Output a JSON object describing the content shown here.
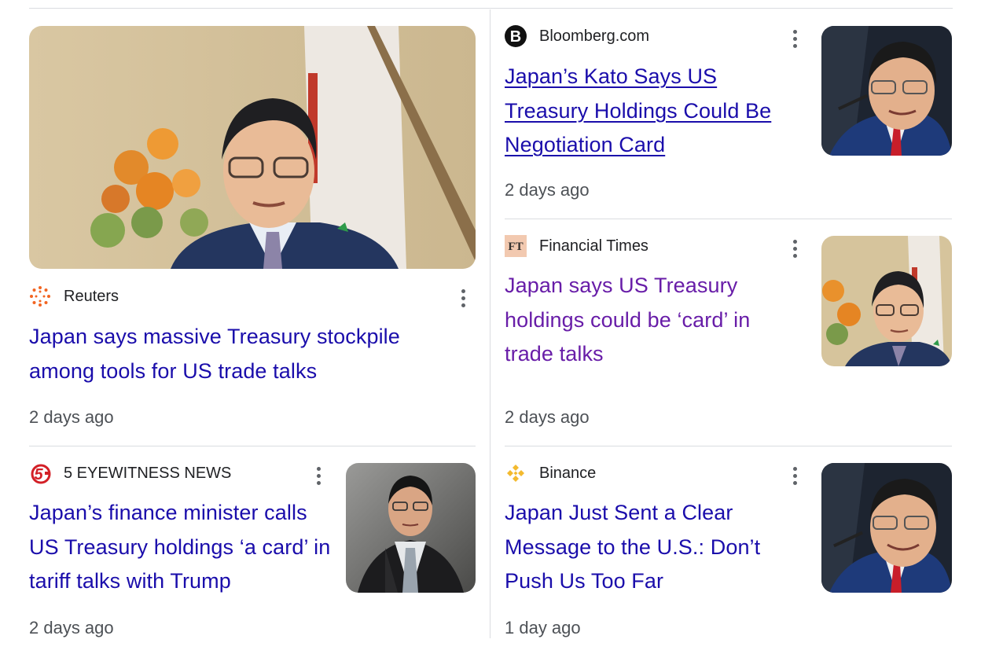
{
  "articles": [
    {
      "source": "Reuters",
      "source_logo": "reuters-logo",
      "title": "Japan says massive Treasury stockpile among tools for US trade talks",
      "time": "2 days ago",
      "title_state": "default",
      "image": "photo-official-smiling-flag"
    },
    {
      "source": "Bloomberg.com",
      "source_logo": "bloomberg-logo",
      "title": "Japan’s Kato Says US Treasury Holdings Could Be Negotiation Card",
      "time": "2 days ago",
      "title_state": "hover-underlined",
      "image": "photo-official-speaking"
    },
    {
      "source": "Financial Times",
      "source_logo": "ft-logo",
      "title": "Japan says US Treasury holdings could be ‘card’ in trade talks",
      "time": "2 days ago",
      "title_state": "visited",
      "image": "photo-official-smiling-flag"
    },
    {
      "source": "5 EYEWITNESS NEWS",
      "source_logo": "5-eyewitness-logo",
      "title": "Japan’s finance minister calls US Treasury holdings ‘a card’ in tariff talks with Trump",
      "time": "2 days ago",
      "title_state": "default",
      "image": "photo-official-suit"
    },
    {
      "source": "Binance",
      "source_logo": "binance-logo",
      "title": "Japan Just Sent a Clear Message to the U.S.: Don’t Push Us Too Far",
      "time": "1 day ago",
      "title_state": "default",
      "image": "photo-official-speaking"
    }
  ],
  "colors": {
    "link": "#1a0dab",
    "visited": "#681da8",
    "meta": "#4d5156",
    "divider": "#dadce0"
  }
}
